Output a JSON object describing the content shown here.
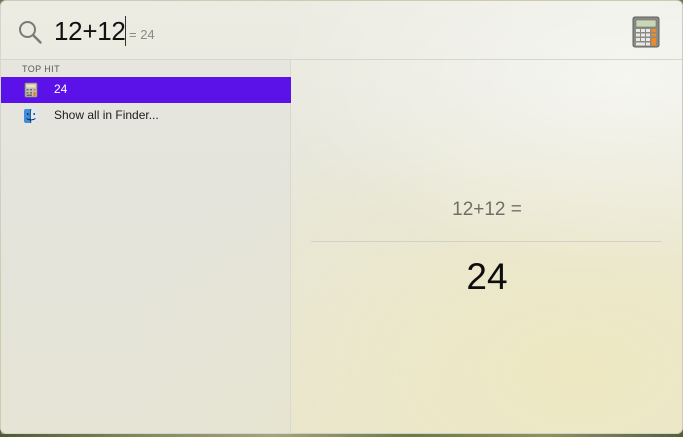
{
  "search": {
    "query": "12+12",
    "completion": "= 24"
  },
  "results": {
    "section_header": "TOP HIT",
    "items": [
      {
        "label": "24",
        "icon": "calculator-icon",
        "selected": true
      },
      {
        "label": "Show all in Finder...",
        "icon": "finder-icon",
        "selected": false
      }
    ]
  },
  "preview": {
    "expression": "12+12 =",
    "result": "24"
  },
  "colors": {
    "selection": "#5a12e8"
  }
}
